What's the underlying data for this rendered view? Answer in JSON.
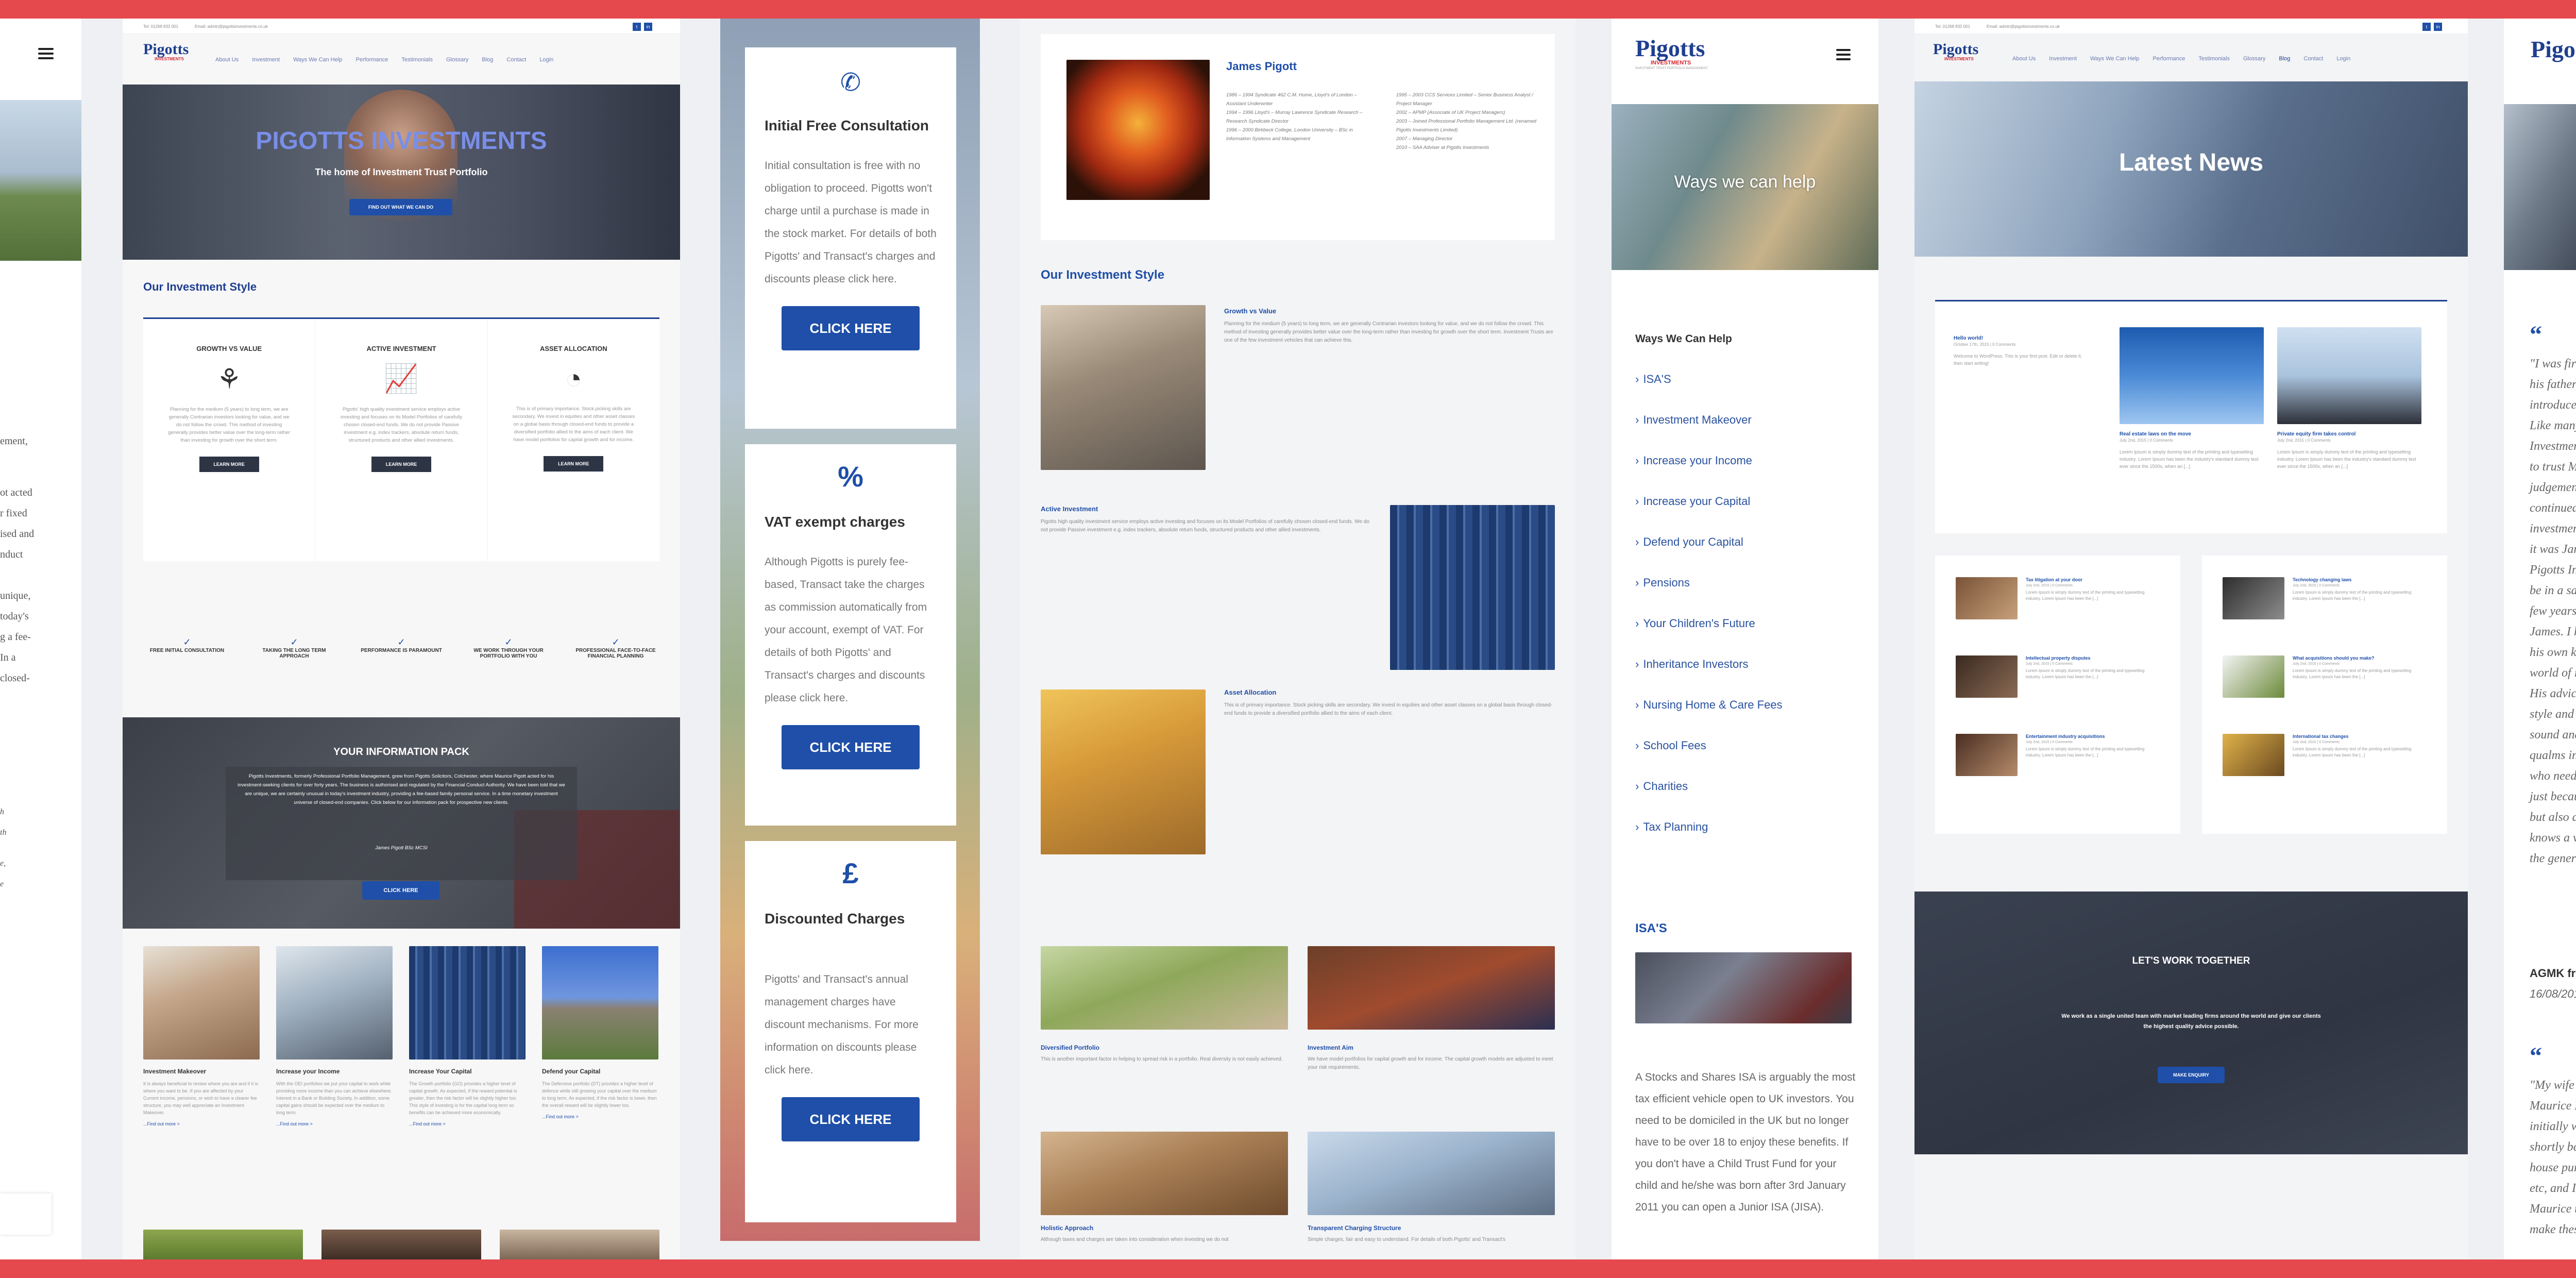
{
  "colors": {
    "accent": "#1f4fa8",
    "brand_red": "#d22630",
    "dark": "#2d3545",
    "frame_red": "#e5484d"
  },
  "panel1": {
    "text_lines": [
      "ement,",
      "ot acted",
      "r fixed",
      "ised and",
      "nduct",
      "unique,",
      "today's",
      "g a fee-",
      "In a",
      "closed-",
      "h",
      "th",
      "e,",
      "e"
    ]
  },
  "panel2": {
    "topbar": {
      "tel": "Tel: 01268 832 001",
      "email": "Email: admin@pigottsinvestments.co.uk"
    },
    "logo": {
      "main": "Pigotts",
      "sub": "INVESTMENTS",
      "tag": "INVESTMENT TRUST PORTFOLIO MANAGEMENT"
    },
    "nav": [
      "About Us",
      "Investment",
      "Ways We Can Help",
      "Performance",
      "Testimonials",
      "Glossary",
      "Blog",
      "Contact",
      "Login"
    ],
    "hero": {
      "title": "PIGOTTS INVESTMENTS",
      "subtitle": "The home of Investment Trust Portfolio",
      "button": "FIND OUT WHAT WE CAN DO"
    },
    "style": {
      "heading": "Our Investment Style",
      "cards": [
        {
          "title": "GROWTH VS VALUE",
          "text": "Planning for the medium (5 years) to long term, we are generally Contrarian investors looking for value, and we do not follow the crowd. This method of investing generally provides better value over the long-term rather than investing for growth over the short term.",
          "button": "LEARN MORE"
        },
        {
          "title": "ACTIVE INVESTMENT",
          "text": "Pigotts' high quality investment service employs active investing and focuses on its Model Portfolios of carefully chosen closed-end funds. We do not provide Passive investment e.g. index trackers, absolute return funds, structured products and other allied investments.",
          "button": "LEARN MORE"
        },
        {
          "title": "ASSET ALLOCATION",
          "text": "This is of primary importance. Stock picking skills are secondary. We invest in equities and other asset classes on a global basis through closed-end funds to provide a diversified portfolio allied to the aims of each client. We have model portfolios for capital growth and for income.",
          "button": "LEARN MORE"
        }
      ]
    },
    "features": [
      "FREE INITIAL CONSULTATION",
      "TAKING THE LONG TERM APPROACH",
      "PERFORMANCE IS PARAMOUNT",
      "WE WORK THROUGH YOUR PORTFOLIO WITH YOU",
      "PROFESSIONAL FACE-TO-FACE FINANCIAL PLANNING"
    ],
    "pack": {
      "title": "YOUR INFORMATION PACK",
      "text": "Pigotts Investments, formerly Professional Portfolio Management, grew from Pigotts Solicitors, Colchester, where Maurice Pigott acted for his investment-seeking clients for over forty years. The business is authorised and regulated by the Financial Conduct Authority. We have been told that we are unique, we are certainly unusual in today's investment industry, providing a fee-based family personal service. In a time monetary investment universe of closed-end companies. Click below for our information pack for prospective new clients.",
      "sign": "James Pigott BSc MCSI",
      "button": "CLICK HERE"
    },
    "help": [
      {
        "title": "Investment Makeover",
        "text": "It is always beneficial to review where you are and if it is where you want to be. If you are affected by your Current income, pensions, or wish to have a clearer fee structure, you may well appreciate an Investment Makeover.",
        "link": "...Find out more >"
      },
      {
        "title": "Increase your Income",
        "text": "With the OEI portfolios we put your capital to work while providing more income than you can achieve elsewhere. Interest in a Bank or Building Society. In addition, some capital gains should be expected over the medium to long term.",
        "link": "...Find out more >"
      },
      {
        "title": "Increase Your Capital",
        "text": "The Growth portfolio (GO) provides a higher level of capital growth. As expected, if the reward potential is greater, then the risk factor will be slightly higher too. This style of investing is for the capital long term so benefits can be achieved more economically.",
        "link": "...Find out more >"
      },
      {
        "title": "Defend your Capital",
        "text": "The Defensive portfolio (DT) provides a higher level of defence while still growing your capital over the medium to long term. As expected, if the risk factor is lower, then the overall reward will be slightly lower too.",
        "link": "...Find out more >"
      }
    ]
  },
  "panel3": {
    "cards": [
      {
        "icon": "✆",
        "title": "Initial Free Consultation",
        "text": "Initial consultation is free with no obligation to proceed. Pigotts won't charge until a purchase is made in the stock market. For details of both Pigotts' and Transact's charges and discounts please click here.",
        "button": "CLICK HERE"
      },
      {
        "icon": "%",
        "title": "VAT exempt charges",
        "text": "Although Pigotts is purely fee-based, Transact take the charges as commission automatically from your account, exempt of VAT. For details of both Pigotts' and Transact's charges and discounts please click here.",
        "button": "CLICK HERE"
      },
      {
        "icon": "£",
        "title": "Discounted Charges",
        "text": "Pigotts' and Transact's annual management charges have discount mechanisms. For more information on discounts please click here.",
        "button": "CLICK HERE"
      }
    ]
  },
  "panel4": {
    "bio": {
      "name": "James Pigott",
      "col1": [
        "1986 – 1994 Syndicate 462 C.M. Hume, Lloyd's of London – Assistant Underwriter",
        "1994 – 1996 Lloyd's – Murray Lawrence Syndicate Research – Research Syndicate Director",
        "1996 – 2000 Birkbeck College, London University – BSc in Information Systems and Management"
      ],
      "col2": [
        "1995 – 2003 CCS Services Limited – Senior Business Analyst / Project Manager",
        "2002 – APMP (Associate of UK Project Managers)",
        "2003 – Joined Professional Portfolio Management Ltd. (renamed Pigotts Investments Limited)",
        "2007 – Managing Director",
        "2010 – SAA Adviser at Pigotts Investments"
      ]
    },
    "heading": "Our Investment Style",
    "sections": [
      {
        "title": "Growth vs Value",
        "text": "Planning for the medium (5 years) to long term, we are generally Contrarian investors looking for value, and we do not follow the crowd. This method of investing generally provides better value over the long-term rather than investing for growth over the short term. Investment Trusts are one of the few investment vehicles that can achieve this."
      },
      {
        "title": "Active Investment",
        "text": "Pigotts high quality investment service employs active investing and focuses on its Model Portfolios of carefully chosen closed-end funds. We do not provide Passive investment e.g. index trackers, absolute return funds, structured products and other allied investments."
      },
      {
        "title": "Asset Allocation",
        "text": "This is of primary importance. Stock picking skills are secondary. We invest in equities and other asset classes on a global basis through closed-end funds to provide a diversified portfolio allied to the aims of each client."
      }
    ],
    "grid": [
      {
        "title": "Diversified Portfolio",
        "text": "This is another important factor in helping to spread risk in a portfolio. Real diversity is not easily achieved."
      },
      {
        "title": "Investment Aim",
        "text": "We have model portfolios for capital growth and for income. The capital growth models are adjusted to meet your risk requirements."
      },
      {
        "title": "Holistic Approach",
        "text": "Although taxes and charges are taken into consideration when investing we do not"
      },
      {
        "title": "Transparent Charging Structure",
        "text": "Simple charges, fair and easy to understand. For details of both Pigotts' and Transact's"
      }
    ]
  },
  "panel5": {
    "logo": {
      "main": "Pigotts",
      "sub": "INVESTMENTS",
      "tag": "INVESTMENT TRUST PORTFOLIO MANAGEMENT"
    },
    "hero": "Ways we can help",
    "heading": "Ways We Can Help",
    "list": [
      "ISA'S",
      "Investment Makeover",
      "Increase your Income",
      "Increase your Capital",
      "Defend your Capital",
      "Pensions",
      "Your Children's Future",
      "Inheritance Investors",
      "Nursing Home & Care Fees",
      "School Fees",
      "Charities",
      "Tax Planning"
    ],
    "isa": {
      "title": "ISA'S",
      "text": "A Stocks and Shares ISA is arguably the most tax efficient vehicle open to UK investors. You need to be domiciled in the UK but no longer have to be over 18 to enjoy these benefits.  If you don't have a Child Trust Fund for your child and he/she was born after 3rd January 2011 you can open a Junior ISA (JISA)."
    }
  },
  "panel6": {
    "topbar": {
      "tel": "Tel: 01268 832 001",
      "email": "Email: admin@pigottsinvestments.co.uk"
    },
    "nav": [
      "About Us",
      "Investment",
      "Ways We Can Help",
      "Performance",
      "Testimonials",
      "Glossary",
      "Blog",
      "Contact",
      "Login"
    ],
    "hero": "Latest News",
    "posts": [
      {
        "title": "Hello world!",
        "meta": "October 17th, 2015 | 0 Comments",
        "text": "Welcome to WordPress. This is your first post. Edit or delete it, then start writing!"
      },
      {
        "title": "Real estate laws on the move",
        "meta": "July 2nd, 2015 | 0 Comments",
        "text": "Lorem Ipsum is simply dummy text of the printing and typesetting industry. Lorem Ipsum has been the industry's standard dummy text ever since the 1500s, when an [...]"
      },
      {
        "title": "Private equity firm takes control",
        "meta": "July 2nd, 2015 | 0 Comments",
        "text": "Lorem Ipsum is simply dummy text of the printing and typesetting industry. Lorem Ipsum has been the industry's standard dummy text ever since the 1500s, when an [...]"
      }
    ],
    "mini": [
      {
        "title": "Tax litigation at your door",
        "meta": "July 2nd, 2015 | 0 Comments",
        "text": "Lorem Ipsum is simply dummy text of the printing and typesetting industry. Lorem Ipsum has been the [...]"
      },
      {
        "title": "Technology changing laws",
        "meta": "July 2nd, 2015 | 0 Comments",
        "text": "Lorem Ipsum is simply dummy text of the printing and typesetting industry. Lorem Ipsum has been the [...]"
      },
      {
        "title": "Intellectual property disputes",
        "meta": "July 2nd, 2015 | 0 Comments",
        "text": "Lorem Ipsum is simply dummy text of the printing and typesetting industry. Lorem Ipsum has been the [...]"
      },
      {
        "title": "What acquisitions should you make?",
        "meta": "July 2nd, 2015 | 0 Comments",
        "text": "Lorem Ipsum is simply dummy text of the printing and typesetting industry. Lorem Ipsum has been the [...]"
      },
      {
        "title": "Entertainment industry acquisitions",
        "meta": "July 2nd, 2015 | 0 Comments",
        "text": "Lorem Ipsum is simply dummy text of the printing and typesetting industry. Lorem Ipsum has been the [...]"
      },
      {
        "title": "International tax changes",
        "meta": "July 2nd, 2015 | 0 Comments",
        "text": "Lorem Ipsum is simply dummy text of the printing and typesetting industry. Lorem Ipsum has been the [...]"
      }
    ],
    "cta": {
      "title": "LET'S WORK TOGETHER",
      "text": "We work as a single united team with market leading firms around the world and give our clients the highest quality advice possible.",
      "button": "MAKE ENQUIRY"
    }
  },
  "panel7": {
    "logo": "Pigo",
    "quote1": [
      "\"I was first i",
      "his father, M",
      "introduced i",
      "Like many o",
      "Investments",
      "to trust Mau",
      "judgement c",
      "continued h",
      "investments",
      "it was James",
      "Pigotts Inve",
      "be in a safe",
      "few years sir",
      "James. I hav",
      "his own kno",
      "world of inv",
      "His advice is",
      "style and go",
      "sound and r",
      "qualms in r",
      "who needs s",
      "just becaus",
      "but also as",
      "knows a ver",
      "the general"
    ],
    "author1": "AGMK from",
    "date1": "16/08/2012",
    "quote2": [
      "\"My wife an",
      "Maurice Pig",
      "initially with",
      "shortly befo",
      "house purc",
      "etc, and I c",
      "Maurice tha",
      "make these"
    ]
  }
}
